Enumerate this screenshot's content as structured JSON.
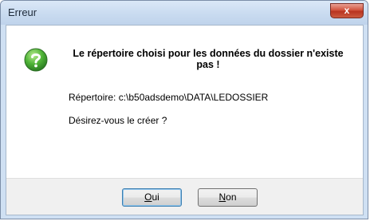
{
  "window": {
    "title": "Erreur",
    "close_label": "x"
  },
  "dialog": {
    "icon": "question-icon",
    "heading": "Le répertoire choisi pour les données du dossier n'existe pas !",
    "directory_line": "Répertoire: c:\\b50adsdemo\\DATA\\LEDOSSIER",
    "question": "Désirez-vous le créer ?"
  },
  "buttons": {
    "yes": {
      "label": "Oui",
      "mnemonic": "O",
      "rest": "ui"
    },
    "no": {
      "label": "Non",
      "mnemonic": "N",
      "rest": "on"
    }
  },
  "colors": {
    "close_button": "#c94a32",
    "question_icon": "#3aa12e",
    "default_button_border": "#3c7fb1"
  }
}
